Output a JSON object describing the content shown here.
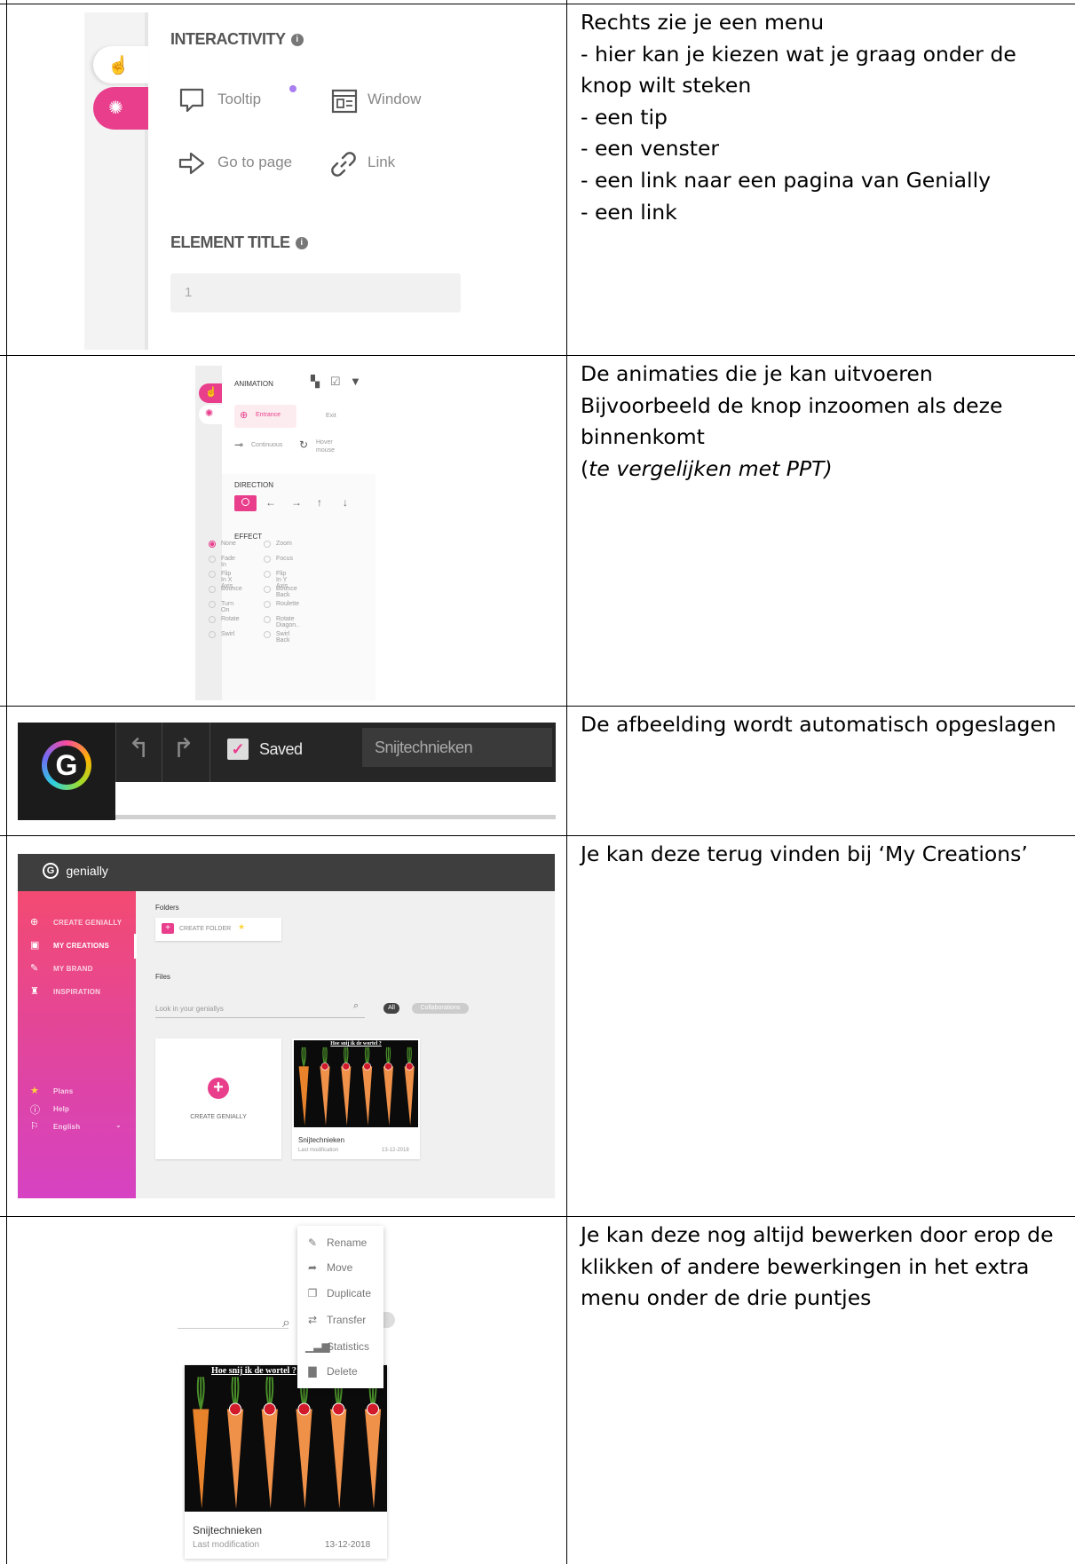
{
  "rows": [
    {
      "lines": [
        "Rechts zie je een menu",
        "- hier kan je kiezen wat je graag onder de knop wilt steken",
        "- een tip",
        "- een venster",
        "- een link naar een pagina van Genially",
        "- een link"
      ]
    },
    {
      "lines": [
        "De animaties die je kan uitvoeren",
        "Bijvoorbeeld de knop inzoomen als deze binnenkomt"
      ],
      "note_open": "(",
      "note_italic": "te vergelijken met PPT)"
    },
    {
      "lines": [
        "De afbeelding wordt automatisch opgeslagen"
      ]
    },
    {
      "lines": [
        "Je kan deze terug vinden bij ‘My Creations’"
      ]
    },
    {
      "lines": [
        "Je kan deze nog altijd bewerken door erop de klikken of andere bewerkingen in het extra menu onder de drie puntjes"
      ]
    }
  ],
  "interactivity": {
    "heading": "INTERACTIVITY",
    "options": {
      "tooltip": "Tooltip",
      "window": "Window",
      "go_to_page": "Go to page",
      "link": "Link"
    },
    "element_title_heading": "ELEMENT TITLE",
    "element_title_value": "1",
    "accent_color": "#e83e8c"
  },
  "animation": {
    "heading": "ANIMATION",
    "tabs": {
      "entrance": "Entrance",
      "exit": "Exit",
      "continuous": "Continuous",
      "hover": "Hover mouse"
    },
    "direction_heading": "DIRECTION",
    "effect_heading": "EFFECT",
    "effects_left": [
      "None",
      "Fade In",
      "Flip In X Axis",
      "Bounce",
      "Turn On",
      "Rotate",
      "Swirl"
    ],
    "effects_right": [
      "Zoom",
      "Focus",
      "Flip In Y Axis",
      "Bounce Back",
      "Roulette",
      "Rotate Diagon..",
      "Swirl Back"
    ],
    "selected_effect": "None"
  },
  "editor_bar": {
    "saved_label": "Saved",
    "title_value": "Snijtechnieken"
  },
  "dashboard": {
    "brand": "genially",
    "nav": [
      "CREATE GENIALLY",
      "MY CREATIONS",
      "MY BRAND",
      "INSPIRATION"
    ],
    "footer_nav": [
      "Plans",
      "Help",
      "English"
    ],
    "folders_label": "Folders",
    "create_folder": "CREATE FOLDER",
    "files_label": "Files",
    "search_placeholder": "Look in your geniallys",
    "filter_all": "All",
    "filter_collab": "Collaborations",
    "create_card_label": "CREATE GENIALLY",
    "file_title": "Snijtechnieken",
    "file_meta": "Last modification",
    "file_date": "13-12-2018",
    "thumb_title": "Hoe snij ik de wortel ?"
  },
  "context_menu": {
    "items": [
      "Rename",
      "Move",
      "Duplicate",
      "Transfer",
      "Statistics",
      "Delete"
    ],
    "thumb_title": "Hoe snij ik de wortel ?",
    "file_title": "Snijtechnieken",
    "file_meta": "Last modification",
    "file_date": "13-12-2018"
  }
}
